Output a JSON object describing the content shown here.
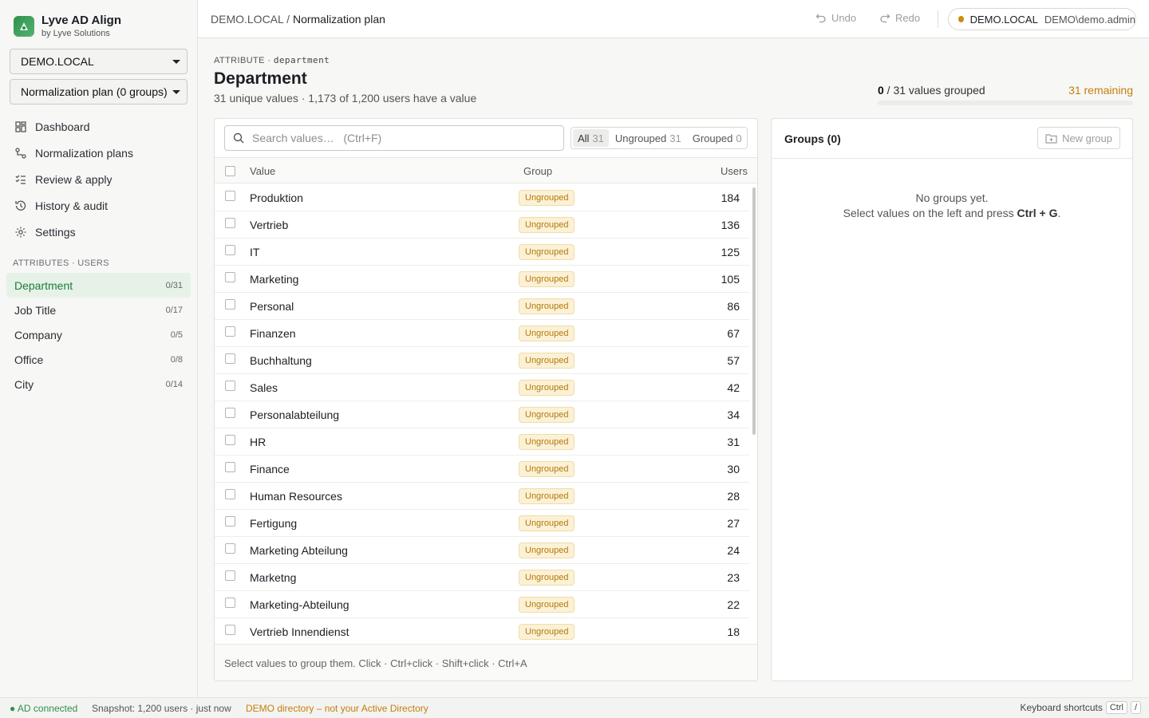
{
  "brand": {
    "name": "Lyve AD Align",
    "by": "by Lyve Solutions"
  },
  "sidebar": {
    "domain_select": "DEMO.LOCAL",
    "plan_select": "Normalization plan (0 groups)",
    "nav": [
      {
        "label": "Dashboard",
        "icon": "dashboard-icon"
      },
      {
        "label": "Normalization plans",
        "icon": "plans-icon"
      },
      {
        "label": "Review & apply",
        "icon": "checklist-icon"
      },
      {
        "label": "History & audit",
        "icon": "history-icon"
      },
      {
        "label": "Settings",
        "icon": "gear-icon"
      }
    ],
    "section_label": "ATTRIBUTES · USERS",
    "attributes": [
      {
        "label": "Department",
        "count": "0/31"
      },
      {
        "label": "Job Title",
        "count": "0/17"
      },
      {
        "label": "Company",
        "count": "0/5"
      },
      {
        "label": "Office",
        "count": "0/8"
      },
      {
        "label": "City",
        "count": "0/14"
      }
    ]
  },
  "topbar": {
    "crumb_root": "DEMO.LOCAL",
    "crumb_sep": "/",
    "crumb_current": "Normalization plan",
    "undo": "Undo",
    "redo": "Redo",
    "conn_domain": "DEMO.LOCAL",
    "conn_user": "DEMO\\demo.admin"
  },
  "main": {
    "attr_prefix": "ATTRIBUTE ·",
    "attr_code": "department",
    "title": "Department",
    "subtitle": "31 unique values · 1,173 of 1,200 users have a value",
    "progress_grouped": "0",
    "progress_rest": " / 31 values grouped",
    "progress_fraction": 0,
    "remaining": "31 remaining"
  },
  "values_panel": {
    "search_placeholder": "Search values…   (Ctrl+F)",
    "filters": [
      {
        "label": "All",
        "count": "31"
      },
      {
        "label": "Ungrouped",
        "count": "31"
      },
      {
        "label": "Grouped",
        "count": "0"
      }
    ],
    "columns": {
      "value": "Value",
      "group": "Group",
      "users": "Users"
    },
    "rows": [
      {
        "value": "Produktion",
        "group": "Ungrouped",
        "users": "184"
      },
      {
        "value": "Vertrieb",
        "group": "Ungrouped",
        "users": "136"
      },
      {
        "value": "IT",
        "group": "Ungrouped",
        "users": "125"
      },
      {
        "value": "Marketing",
        "group": "Ungrouped",
        "users": "105"
      },
      {
        "value": "Personal",
        "group": "Ungrouped",
        "users": "86"
      },
      {
        "value": "Finanzen",
        "group": "Ungrouped",
        "users": "67"
      },
      {
        "value": "Buchhaltung",
        "group": "Ungrouped",
        "users": "57"
      },
      {
        "value": "Sales",
        "group": "Ungrouped",
        "users": "42"
      },
      {
        "value": "Personalabteilung",
        "group": "Ungrouped",
        "users": "34"
      },
      {
        "value": "HR",
        "group": "Ungrouped",
        "users": "31"
      },
      {
        "value": "Finance",
        "group": "Ungrouped",
        "users": "30"
      },
      {
        "value": "Human Resources",
        "group": "Ungrouped",
        "users": "28"
      },
      {
        "value": "Fertigung",
        "group": "Ungrouped",
        "users": "27"
      },
      {
        "value": "Marketing Abteilung",
        "group": "Ungrouped",
        "users": "24"
      },
      {
        "value": "Marketng",
        "group": "Ungrouped",
        "users": "23"
      },
      {
        "value": "Marketing-Abteilung",
        "group": "Ungrouped",
        "users": "22"
      },
      {
        "value": "Vertrieb Innendienst",
        "group": "Ungrouped",
        "users": "18"
      }
    ],
    "hint": "Select values to group them. Click · Ctrl+click · Shift+click · Ctrl+A"
  },
  "groups_panel": {
    "title": "Groups (0)",
    "new_group": "New group",
    "empty_line1": "No groups yet.",
    "empty_line2_pre": "Select values on the left and press ",
    "empty_line2_key": "Ctrl + G",
    "empty_line2_post": "."
  },
  "statusbar": {
    "connected": "● AD connected",
    "snapshot": "Snapshot: 1,200 users · just now",
    "demo_notice": "DEMO directory – not your Active Directory",
    "shortcuts": "Keyboard shortcuts",
    "key1": "Ctrl",
    "key2": "/"
  },
  "colors": {
    "accent": "#2f8f4e",
    "warning": "#c47f0a",
    "badge_bg": "#fbf1d6"
  }
}
